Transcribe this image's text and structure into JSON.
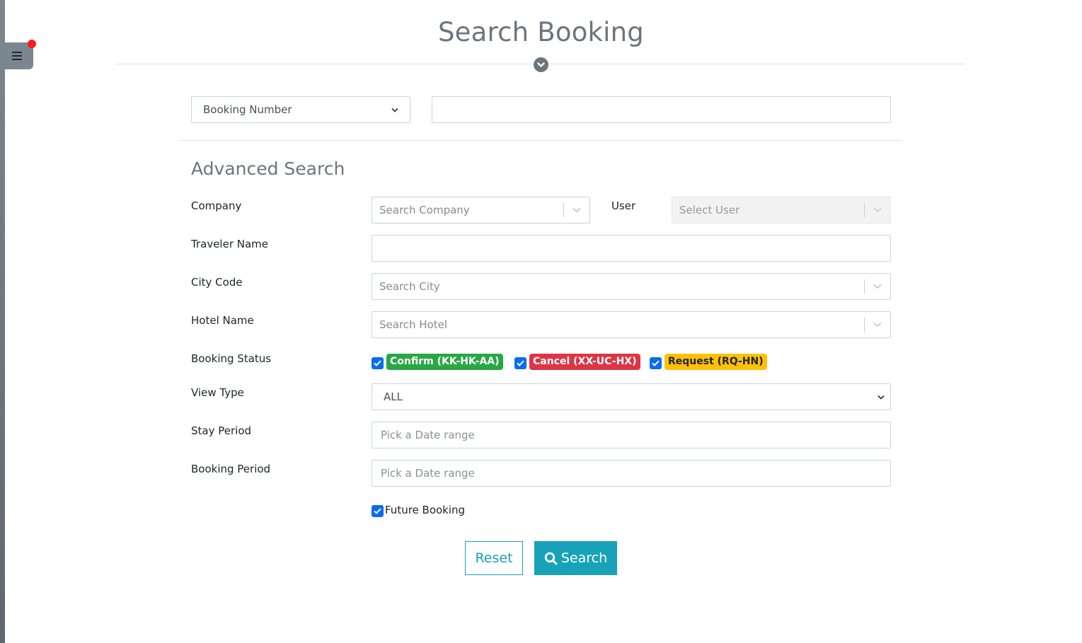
{
  "header": {
    "title": "Search Booking",
    "menu_icon": "hamburger-menu-icon",
    "notification_indicator": "red-dot",
    "collapse_icon": "chevron-circle-down-icon"
  },
  "quick_search": {
    "type_selected": "Booking Number",
    "value": "",
    "value_placeholder": ""
  },
  "advanced": {
    "title": "Advanced Search",
    "company": {
      "label": "Company",
      "placeholder": "Search Company"
    },
    "user": {
      "label": "User",
      "placeholder": "Select User",
      "disabled": true
    },
    "traveler_name": {
      "label": "Traveler Name",
      "value": ""
    },
    "city_code": {
      "label": "City Code",
      "placeholder": "Search City"
    },
    "hotel_name": {
      "label": "Hotel Name",
      "placeholder": "Search Hotel"
    },
    "booking_status": {
      "label": "Booking Status",
      "options": [
        {
          "label": "Confirm (KK-HK-AA)",
          "checked": true,
          "color": "#28a745",
          "text_color": "#ffffff"
        },
        {
          "label": "Cancel (XX-UC-HX)",
          "checked": true,
          "color": "#dc3545",
          "text_color": "#ffffff"
        },
        {
          "label": "Request (RQ-HN)",
          "checked": true,
          "color": "#ffc107",
          "text_color": "#212529"
        }
      ]
    },
    "view_type": {
      "label": "View Type",
      "selected": "ALL"
    },
    "stay_period": {
      "label": "Stay Period",
      "placeholder": "Pick a Date range",
      "value": ""
    },
    "booking_period": {
      "label": "Booking Period",
      "placeholder": "Pick a Date range",
      "value": ""
    },
    "future_booking": {
      "label": "Future Booking",
      "checked": true
    }
  },
  "actions": {
    "reset_label": "Reset",
    "search_label": "Search",
    "accent_color": "#17a2b8"
  }
}
